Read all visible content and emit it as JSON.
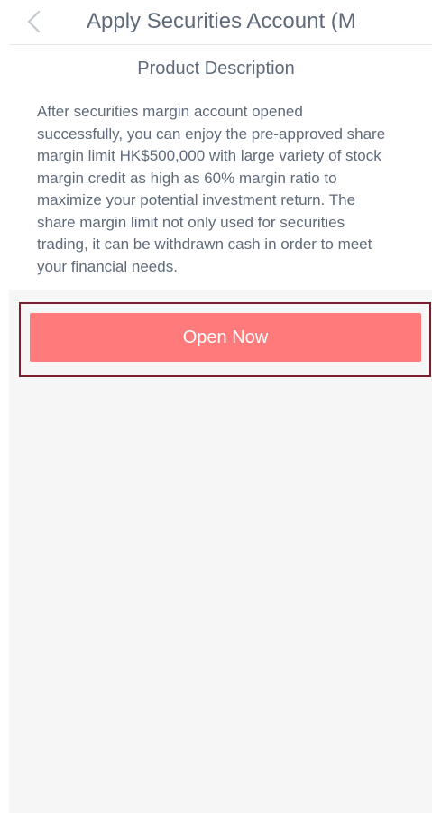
{
  "header": {
    "back_icon": "chevron-left-icon",
    "title": "Apply Securities Account (M"
  },
  "content": {
    "section_title": "Product Description",
    "description_lines": [
      "After securities margin account opened",
      "successfully, you can enjoy the pre-approved share",
      "margin limit HK$500,000 with large variety of stock",
      "margin credit as high as 60% margin ratio to",
      "maximize your potential investment return. The",
      "share margin limit not only used for securities",
      "trading, it can be withdrawn cash in order to meet",
      "your financial needs."
    ]
  },
  "actions": {
    "open_now_label": "Open Now"
  },
  "colors": {
    "text": "#5f6b7a",
    "button": "#ff7b7b",
    "button_text": "#ffffff",
    "highlight_border": "#7a1f2b",
    "lower_background": "#f6f6f7"
  }
}
